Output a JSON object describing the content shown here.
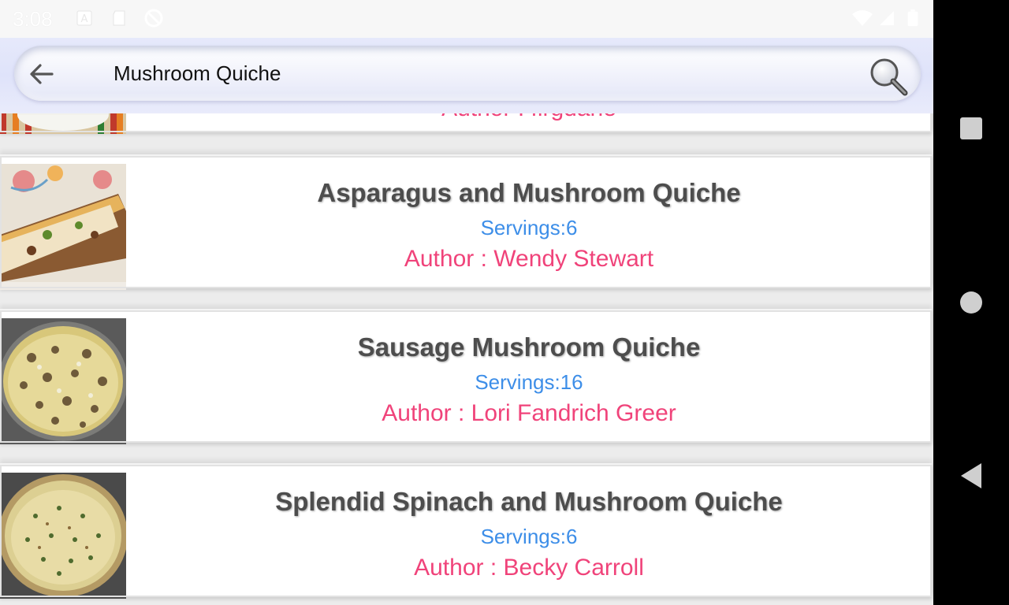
{
  "status_bar": {
    "time": "3:08",
    "icons": [
      "notification-a-icon",
      "sd-card-icon",
      "sync-disabled-icon",
      "wifi-icon",
      "signal-icon",
      "battery-icon"
    ]
  },
  "search": {
    "query": "Mushroom Quiche",
    "back_icon": "arrow-left-icon",
    "search_icon": "magnifier-icon"
  },
  "partial_card": {
    "author": "Author : flrgdane"
  },
  "recipes": [
    {
      "title": "Asparagus and Mushroom Quiche",
      "servings": "Servings:6",
      "author": "Author : Wendy Stewart"
    },
    {
      "title": "Sausage Mushroom Quiche",
      "servings": "Servings:16",
      "author": "Author : Lori Fandrich Greer"
    },
    {
      "title": "Splendid Spinach and Mushroom Quiche",
      "servings": "Servings:6",
      "author": "Author : Becky Carroll"
    }
  ],
  "colors": {
    "title": "#4d4d4d",
    "servings": "#3d8ee8",
    "author": "#f0437a",
    "search_bg": "#e2e6fa"
  },
  "nav": {
    "icons": [
      "recents-square-icon",
      "home-circle-icon",
      "back-triangle-icon"
    ]
  }
}
